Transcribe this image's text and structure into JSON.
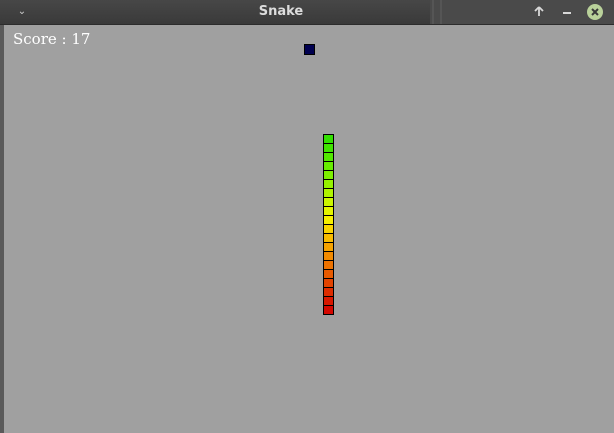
{
  "window": {
    "title": "Snake",
    "menu_icon": "chevron-down-icon",
    "buttons": {
      "maximize_icon": "arrow-up-icon",
      "minimize_icon": "minus-icon",
      "close_icon": "close-icon"
    }
  },
  "game": {
    "score_label": "Score : 17",
    "background_color": "#a0a0a0",
    "food_color": "#000050",
    "snake_segment_colors": [
      "#33e000",
      "#40e400",
      "#52e800",
      "#66ec00",
      "#7df000",
      "#95f200",
      "#b0f400",
      "#cbf600",
      "#e4f500",
      "#f6ef00",
      "#f9d400",
      "#f8bb00",
      "#f5a200",
      "#f18a00",
      "#ec7200",
      "#e75a00",
      "#e24300",
      "#dd2c00",
      "#d81800",
      "#d40800"
    ]
  }
}
